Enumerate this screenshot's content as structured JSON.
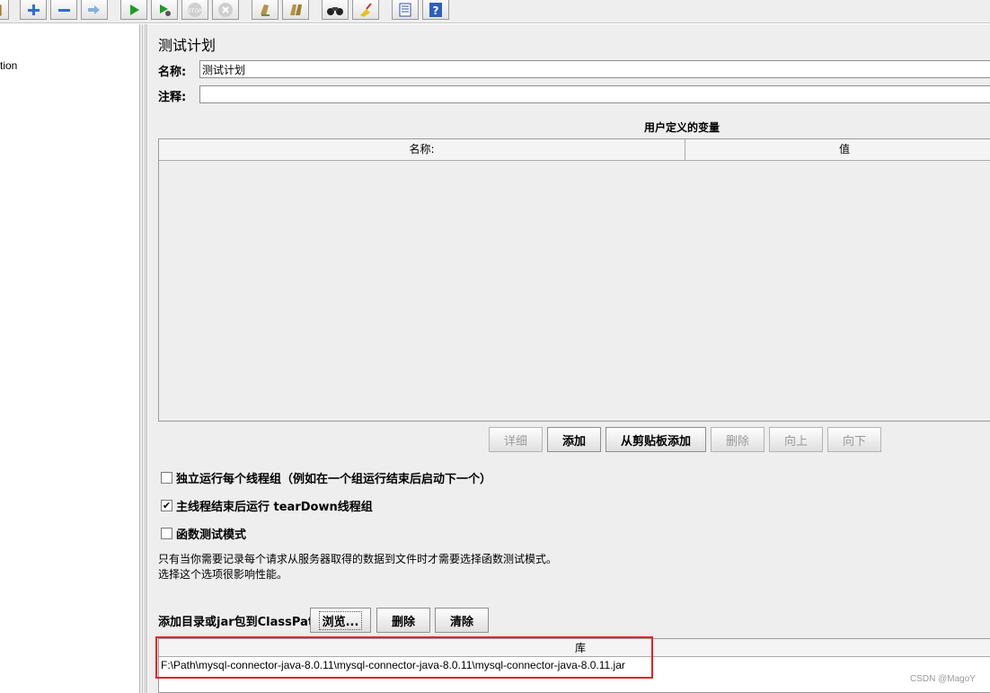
{
  "toolbar": {
    "buttons": [
      {
        "name": "open-icon",
        "interactable": true
      },
      {
        "name": "expand-icon",
        "interactable": true
      },
      {
        "name": "collapse-icon",
        "interactable": true
      },
      {
        "name": "toggle-icon",
        "interactable": true
      },
      {
        "name": "start-icon",
        "interactable": true
      },
      {
        "name": "start-no-pause-icon",
        "interactable": true
      },
      {
        "name": "stop-icon",
        "interactable": false
      },
      {
        "name": "shutdown-icon",
        "interactable": false
      },
      {
        "name": "clear-icon",
        "interactable": true
      },
      {
        "name": "clear-all-icon",
        "interactable": true
      },
      {
        "name": "search-icon",
        "interactable": true
      },
      {
        "name": "reset-search-icon",
        "interactable": true
      },
      {
        "name": "function-helper-icon",
        "interactable": true
      },
      {
        "name": "help-icon",
        "interactable": true
      }
    ]
  },
  "tree": {
    "item_partial": "tion"
  },
  "main": {
    "title": "测试计划",
    "name_label": "名称:",
    "name_value": "测试计划",
    "comment_label": "注释:",
    "comment_value": "",
    "variables_title": "用户定义的变量",
    "col_name": "名称:",
    "col_value": "值",
    "buttons": {
      "detail": "详细",
      "add": "添加",
      "add_from_clipboard": "从剪贴板添加",
      "delete": "删除",
      "up": "向上",
      "down": "向下"
    },
    "checkboxes": {
      "serialize": {
        "label": "独立运行每个线程组（例如在一个组运行结束后启动下一个）",
        "checked": false
      },
      "teardown": {
        "label": "主线程结束后运行 tearDown线程组",
        "checked": true
      },
      "functional": {
        "label": "函数测试模式",
        "checked": false
      }
    },
    "functional_note_line1": "只有当你需要记录每个请求从服务器取得的数据到文件时才需要选择函数测试模式。",
    "functional_note_line2": "选择这个选项很影响性能。",
    "classpath_label": "添加目录或jar包到ClassPath",
    "classpath_buttons": {
      "browse": "浏览...",
      "delete": "删除",
      "clear": "清除"
    },
    "library_header": "库",
    "library_rows": [
      "F:\\Path\\mysql-connector-java-8.0.11\\mysql-connector-java-8.0.11\\mysql-connector-java-8.0.11.jar"
    ]
  },
  "watermark": "CSDN @MagoY",
  "colors": {
    "panel_bg": "#eeeeee",
    "highlight": "#e0242a",
    "disabled_text": "#9a9a9a"
  }
}
